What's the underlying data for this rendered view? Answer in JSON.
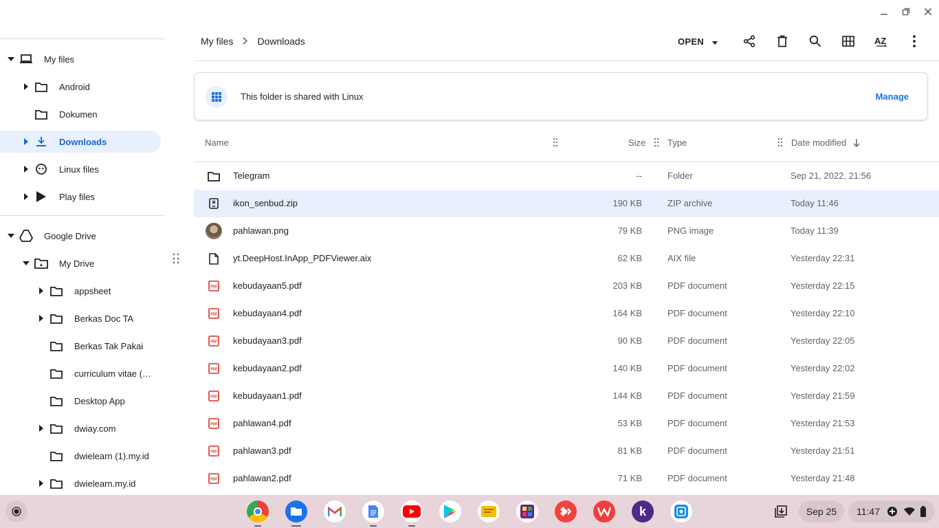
{
  "window": {
    "minimize": "minimize",
    "restore": "restore",
    "close": "close"
  },
  "sidebar": {
    "my_files": "My files",
    "android": "Android",
    "dokumen": "Dokumen",
    "downloads": "Downloads",
    "linux_files": "Linux files",
    "play_files": "Play files",
    "google_drive": "Google Drive",
    "my_drive": "My Drive",
    "drive_items": [
      "appsheet",
      "Berkas Doc TA",
      "Berkas Tak Pakai",
      "curriculum vitae (…",
      "Desktop App",
      "dwiay.com",
      "dwielearn (1).my.id",
      "dwielearn.my.id"
    ]
  },
  "breadcrumb": {
    "root": "My files",
    "current": "Downloads"
  },
  "toolbar": {
    "open_label": "OPEN"
  },
  "banner": {
    "text": "This folder is shared with Linux",
    "action": "Manage"
  },
  "table": {
    "headers": {
      "name": "Name",
      "size": "Size",
      "type": "Type",
      "date": "Date modified"
    },
    "rows": [
      {
        "name": "Telegram",
        "size": "--",
        "type": "Folder",
        "date": "Sep 21, 2022, 21:56",
        "icon": "folder-icon"
      },
      {
        "name": "ikon_senbud.zip",
        "size": "190 KB",
        "type": "ZIP archive",
        "date": "Today 11:46",
        "icon": "zip-icon"
      },
      {
        "name": "pahlawan.png",
        "size": "79 KB",
        "type": "PNG image",
        "date": "Today 11:39",
        "icon": "image-thumbnail"
      },
      {
        "name": "yt.DeepHost.InApp_PDFViewer.aix",
        "size": "62 KB",
        "type": "AIX file",
        "date": "Yesterday 22:31",
        "icon": "file-icon"
      },
      {
        "name": "kebudayaan5.pdf",
        "size": "203 KB",
        "type": "PDF document",
        "date": "Yesterday 22:15",
        "icon": "pdf-icon"
      },
      {
        "name": "kebudayaan4.pdf",
        "size": "164 KB",
        "type": "PDF document",
        "date": "Yesterday 22:10",
        "icon": "pdf-icon"
      },
      {
        "name": "kebudayaan3.pdf",
        "size": "90 KB",
        "type": "PDF document",
        "date": "Yesterday 22:05",
        "icon": "pdf-icon"
      },
      {
        "name": "kebudayaan2.pdf",
        "size": "140 KB",
        "type": "PDF document",
        "date": "Yesterday 22:02",
        "icon": "pdf-icon"
      },
      {
        "name": "kebudayaan1.pdf",
        "size": "144 KB",
        "type": "PDF document",
        "date": "Yesterday 21:59",
        "icon": "pdf-icon"
      },
      {
        "name": "pahlawan4.pdf",
        "size": "53 KB",
        "type": "PDF document",
        "date": "Yesterday 21:53",
        "icon": "pdf-icon"
      },
      {
        "name": "pahlawan3.pdf",
        "size": "81 KB",
        "type": "PDF document",
        "date": "Yesterday 21:51",
        "icon": "pdf-icon"
      },
      {
        "name": "pahlawan2.pdf",
        "size": "71 KB",
        "type": "PDF document",
        "date": "Yesterday 21:48",
        "icon": "pdf-icon"
      }
    ]
  },
  "shelf": {
    "date": "Sep 25",
    "time": "11:47",
    "apps": [
      "chrome-icon",
      "files-icon",
      "gmail-icon",
      "docs-icon",
      "youtube-icon",
      "play-store-icon",
      "keep-icon",
      "photo-app-icon",
      "anydesk-icon",
      "wps-icon",
      "k-app-icon",
      "screenshot-app-icon"
    ]
  },
  "colors": {
    "accent": "#1a73e8",
    "selected_bg": "#e8f0fe",
    "shelf_bg": "#e7d5db",
    "pdf_red": "#d93025"
  }
}
